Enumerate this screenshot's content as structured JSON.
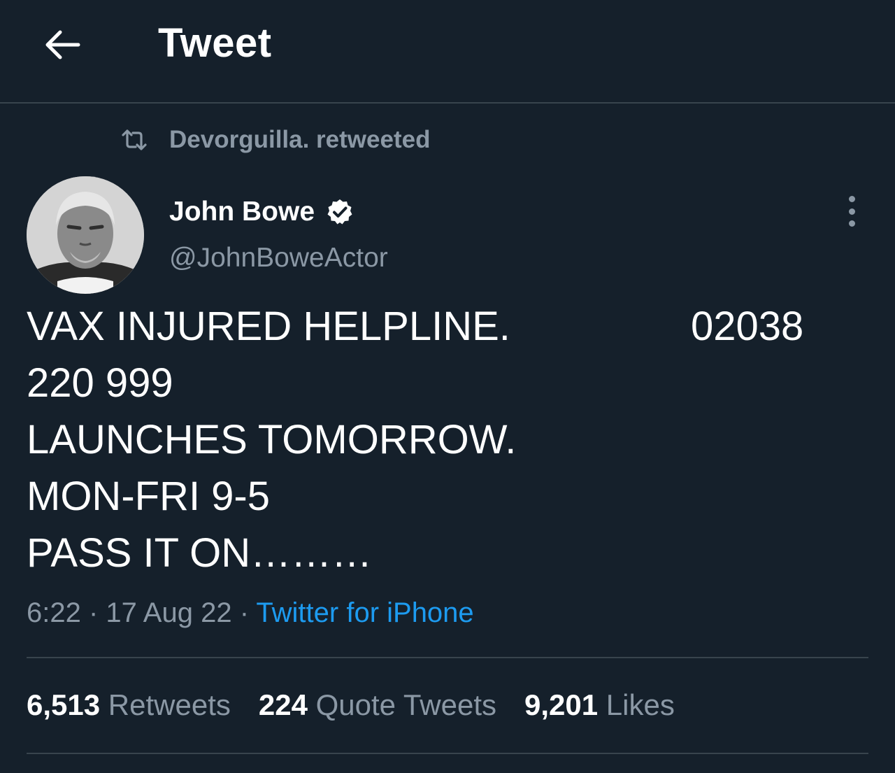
{
  "header": {
    "back_icon": "arrow-left-icon",
    "title": "Tweet"
  },
  "retweet": {
    "icon": "retweet-icon",
    "text": "Devorguilla. retweeted"
  },
  "author": {
    "name": "John Bowe",
    "verified_icon": "verified-badge-icon",
    "handle": "@JohnBoweActor"
  },
  "more_icon": "more-vertical-icon",
  "tweet": {
    "line1_text": "VAX INJURED HELPLINE.",
    "line1_number": "02038",
    "line2": "220 999",
    "line3": "LAUNCHES TOMORROW.",
    "line4": "MON-FRI 9-5",
    "line5": "PASS IT ON………"
  },
  "meta": {
    "time": "6:22",
    "separator": " · ",
    "date": "17 Aug 22",
    "source": "Twitter for iPhone"
  },
  "stats": {
    "retweets_count": "6,513",
    "retweets_label": "Retweets",
    "quotes_count": "224",
    "quotes_label": "Quote Tweets",
    "likes_count": "9,201",
    "likes_label": "Likes"
  },
  "colors": {
    "background": "#15202b",
    "divider": "#38444d",
    "secondary_text": "#8b98a5",
    "link": "#1d9bf0"
  }
}
